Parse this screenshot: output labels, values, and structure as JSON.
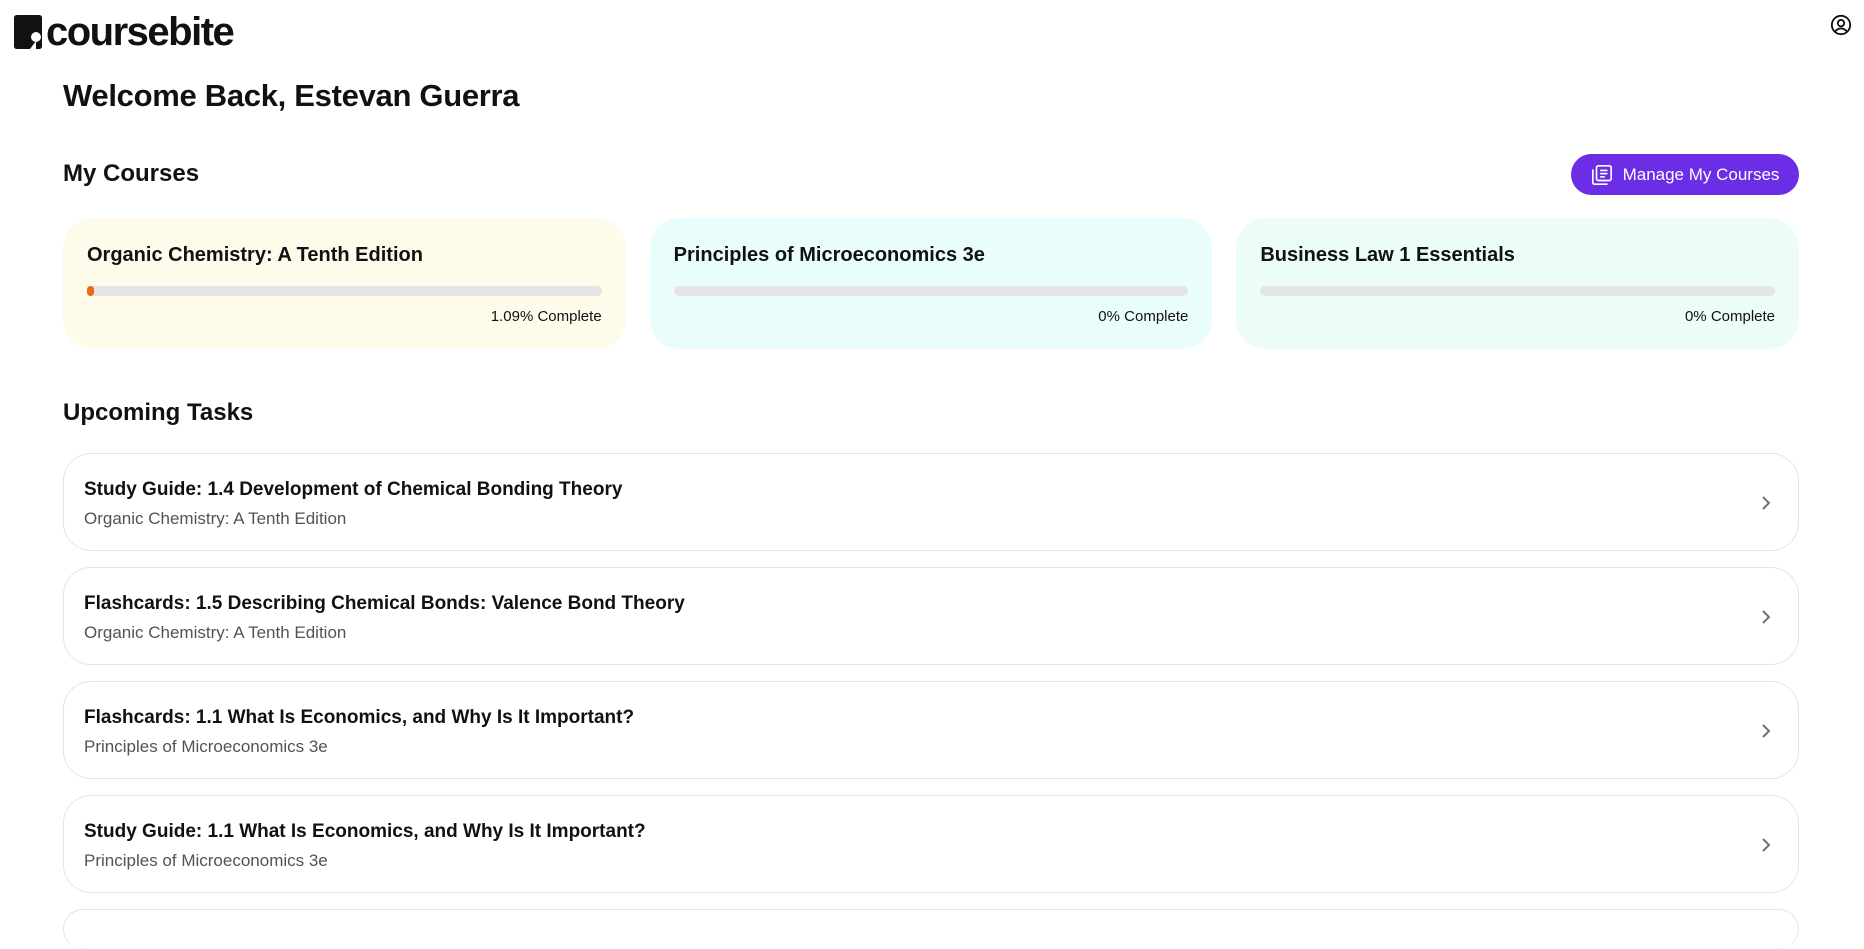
{
  "header": {
    "brand": "coursebite",
    "logo_icon": "book-icon",
    "account_icon": "user-circle-icon"
  },
  "welcome": "Welcome Back, Estevan Guerra",
  "my_courses": {
    "title": "My Courses",
    "manage_button": {
      "label": "Manage My Courses",
      "icon": "library-icon"
    },
    "courses": [
      {
        "title": "Organic Chemistry: A Tenth Edition",
        "progress": 1.09,
        "progress_label": "1.09% Complete",
        "bg": "#fefbea"
      },
      {
        "title": "Principles of Microeconomics 3e",
        "progress": 0,
        "progress_label": "0% Complete",
        "bg": "#e9fdfd"
      },
      {
        "title": "Business Law 1 Essentials",
        "progress": 0,
        "progress_label": "0% Complete",
        "bg": "#ebfdf4"
      }
    ]
  },
  "upcoming_tasks": {
    "title": "Upcoming Tasks",
    "items": [
      {
        "title": "Study Guide: 1.4 Development of Chemical Bonding Theory",
        "course": "Organic Chemistry: A Tenth Edition"
      },
      {
        "title": "Flashcards: 1.5 Describing Chemical Bonds: Valence Bond Theory",
        "course": "Organic Chemistry: A Tenth Edition"
      },
      {
        "title": "Flashcards: 1.1 What Is Economics, and Why Is It Important?",
        "course": "Principles of Microeconomics 3e"
      },
      {
        "title": "Study Guide: 1.1 What Is Economics, and Why Is It Important?",
        "course": "Principles of Microeconomics 3e"
      }
    ]
  },
  "colors": {
    "accent": "#6b2ee6",
    "progress_fill": "#ea6a0c",
    "progress_track": "#e4e4e7"
  }
}
